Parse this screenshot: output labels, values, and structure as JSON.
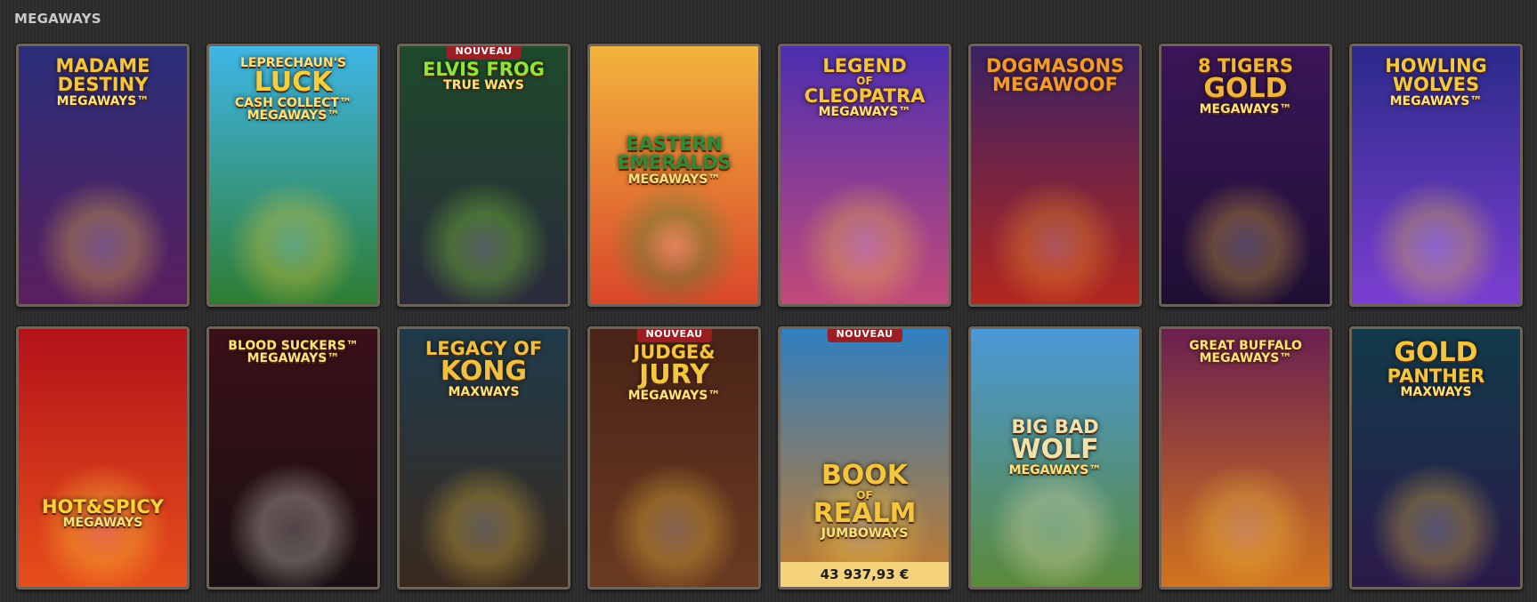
{
  "section": {
    "title": "MEGAWAYS"
  },
  "games": [
    {
      "title_lines": [
        "MADAME",
        "DESTINY",
        "MEGAWAYS™"
      ],
      "badge": "",
      "jackpot": "",
      "bg": "#2a2f7a",
      "bg2": "#5a1f5e",
      "accent": "#f2c542"
    },
    {
      "title_lines": [
        "LEPRECHAUN'S",
        "LUCK",
        "CASH COLLECT™",
        "MEGAWAYS™"
      ],
      "badge": "",
      "jackpot": "",
      "bg": "#3fb6e6",
      "bg2": "#2e7d32",
      "accent": "#f6d03a"
    },
    {
      "title_lines": [
        "ELVIS FROG",
        "TRUE WAYS"
      ],
      "badge": "NOUVEAU",
      "jackpot": "",
      "bg": "#1f4a2c",
      "bg2": "#2a2a3a",
      "accent": "#8ee63c"
    },
    {
      "title_lines": [
        "EASTERN",
        "EMERALDS",
        "MEGAWAYS™"
      ],
      "badge": "",
      "jackpot": "",
      "bg": "#f3b43c",
      "bg2": "#d9472a",
      "accent": "#2e8b3a"
    },
    {
      "title_lines": [
        "LEGEND",
        "OF",
        "CLEOPATRA",
        "MEGAWAYS™"
      ],
      "badge": "",
      "jackpot": "",
      "bg": "#4d2fb0",
      "bg2": "#c24a7a",
      "accent": "#f5c542"
    },
    {
      "title_lines": [
        "DOGMASONS",
        "MEGAWOOF"
      ],
      "badge": "",
      "jackpot": "",
      "bg": "#3a2266",
      "bg2": "#b3261e",
      "accent": "#f29a2e"
    },
    {
      "title_lines": [
        "8 TIGERS",
        "GOLD",
        "MEGAWAYS™"
      ],
      "badge": "",
      "jackpot": "",
      "bg": "#3a1658",
      "bg2": "#1e0f33",
      "accent": "#f0b63c"
    },
    {
      "title_lines": [
        "HOWLING",
        "WOLVES",
        "MEGAWAYS™"
      ],
      "badge": "",
      "jackpot": "",
      "bg": "#2b2a8a",
      "bg2": "#7b3fd0",
      "accent": "#f4c93e"
    },
    {
      "title_lines": [
        "HOT&SPICY",
        "MEGAWAYS"
      ],
      "badge": "",
      "jackpot": "",
      "bg": "#b3121a",
      "bg2": "#e84e1b",
      "accent": "#ffd23a"
    },
    {
      "title_lines": [
        "BLOOD SUCKERS™",
        "MEGAWAYS™"
      ],
      "badge": "",
      "jackpot": "",
      "bg": "#3a1018",
      "bg2": "#1a1012",
      "accent": "#e9e2d6"
    },
    {
      "title_lines": [
        "LEGACY OF",
        "KONG",
        "MAXWAYS"
      ],
      "badge": "",
      "jackpot": "",
      "bg": "#1f3a4a",
      "bg2": "#3a2a1e",
      "accent": "#f0c040"
    },
    {
      "title_lines": [
        "JUDGE&",
        "JURY",
        "MEGAWAYS™"
      ],
      "badge": "NOUVEAU",
      "jackpot": "",
      "bg": "#4a2418",
      "bg2": "#6a3a20",
      "accent": "#f4c640"
    },
    {
      "title_lines": [
        "BOOK",
        "OF",
        "REALM",
        "JUMBOWAYS"
      ],
      "badge": "NOUVEAU",
      "jackpot": "43 937,93 €",
      "bg": "#2f7fc0",
      "bg2": "#c47a2a",
      "accent": "#f4c640"
    },
    {
      "title_lines": [
        "BIG BAD",
        "WOLF",
        "MEGAWAYS™"
      ],
      "badge": "",
      "jackpot": "",
      "bg": "#4a98d8",
      "bg2": "#5a8a3a",
      "accent": "#f0e2b0"
    },
    {
      "title_lines": [
        "GREAT BUFFALO",
        "MEGAWAYS™"
      ],
      "badge": "",
      "jackpot": "",
      "bg": "#6a2050",
      "bg2": "#d2741e",
      "accent": "#f4c640"
    },
    {
      "title_lines": [
        "GOLD",
        "PANTHER",
        "MAXWAYS"
      ],
      "badge": "",
      "jackpot": "",
      "bg": "#123a4a",
      "bg2": "#2a1a4a",
      "accent": "#f4c640"
    }
  ]
}
